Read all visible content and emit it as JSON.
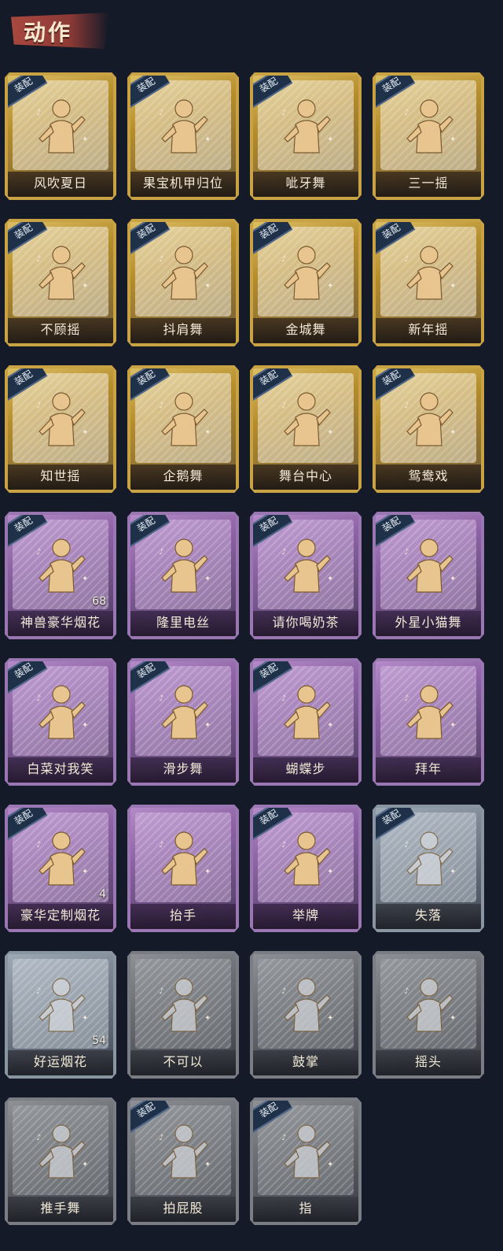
{
  "header": {
    "title": "动作"
  },
  "equip_label": "装配",
  "colors": {
    "gold": "#c9a343",
    "purple": "#9a77b2",
    "silver": "#8a95a2",
    "gray": "#7a7d84",
    "badge": "#1e3148",
    "background": "#151a28"
  },
  "cards": [
    {
      "name": "风吹夏日",
      "rarity": "gold",
      "equipped": true,
      "icon": "figure-wind-icon"
    },
    {
      "name": "果宝机甲归位",
      "rarity": "gold",
      "equipped": true,
      "icon": "figure-mecha-icon"
    },
    {
      "name": "呲牙舞",
      "rarity": "gold",
      "equipped": true,
      "icon": "figure-dance-icon"
    },
    {
      "name": "三一摇",
      "rarity": "gold",
      "equipped": true,
      "icon": "figure-shake-icon"
    },
    {
      "name": "不顾摇",
      "rarity": "gold",
      "equipped": true,
      "icon": "figure-point-icon"
    },
    {
      "name": "抖肩舞",
      "rarity": "gold",
      "equipped": true,
      "icon": "figure-shoulder-icon"
    },
    {
      "name": "金城舞",
      "rarity": "gold",
      "equipped": true,
      "icon": "figure-wave-icon"
    },
    {
      "name": "新年摇",
      "rarity": "gold",
      "equipped": true,
      "icon": "figure-newyear-icon"
    },
    {
      "name": "知世摇",
      "rarity": "gold",
      "equipped": true,
      "icon": "figure-sway-icon"
    },
    {
      "name": "企鹅舞",
      "rarity": "gold",
      "equipped": true,
      "icon": "figure-penguin-icon"
    },
    {
      "name": "舞台中心",
      "rarity": "gold",
      "equipped": true,
      "icon": "figure-stage-icon"
    },
    {
      "name": "鸳鸯戏",
      "rarity": "gold",
      "equipped": true,
      "icon": "figure-duet-icon"
    },
    {
      "name": "神兽豪华烟花",
      "rarity": "purple",
      "equipped": true,
      "icon": "fireworks-icon",
      "count": "68"
    },
    {
      "name": "隆里电丝",
      "rarity": "purple",
      "equipped": true,
      "icon": "figure-point-up-icon"
    },
    {
      "name": "请你喝奶茶",
      "rarity": "purple",
      "equipped": true,
      "icon": "figure-sign-icon"
    },
    {
      "name": "外星小猫舞",
      "rarity": "purple",
      "equipped": true,
      "icon": "figure-cat-icon"
    },
    {
      "name": "白菜对我笑",
      "rarity": "purple",
      "equipped": true,
      "icon": "figure-cross-arms-icon"
    },
    {
      "name": "滑步舞",
      "rarity": "purple",
      "equipped": true,
      "icon": "figure-slide-icon"
    },
    {
      "name": "蝴蝶步",
      "rarity": "purple",
      "equipped": true,
      "icon": "figure-butterfly-icon"
    },
    {
      "name": "拜年",
      "rarity": "purple",
      "equipped": false,
      "icon": "figure-bow-icon"
    },
    {
      "name": "豪华定制烟花",
      "rarity": "purple",
      "equipped": true,
      "icon": "fireworks-box-icon",
      "count": "4"
    },
    {
      "name": "抬手",
      "rarity": "purple",
      "equipped": false,
      "icon": "figure-raise-hand-icon"
    },
    {
      "name": "举牌",
      "rarity": "purple",
      "equipped": true,
      "icon": "figure-hold-sign-icon"
    },
    {
      "name": "失落",
      "rarity": "silver",
      "equipped": true,
      "icon": "figure-kneel-icon"
    },
    {
      "name": "好运烟花",
      "rarity": "silver",
      "equipped": false,
      "icon": "firework-tube-icon",
      "count": "54"
    },
    {
      "name": "不可以",
      "rarity": "gray",
      "equipped": false,
      "icon": "finger-wag-icon"
    },
    {
      "name": "鼓掌",
      "rarity": "gray",
      "equipped": false,
      "icon": "clap-icon"
    },
    {
      "name": "摇头",
      "rarity": "gray",
      "equipped": false,
      "icon": "figure-shake-head-icon"
    },
    {
      "name": "推手舞",
      "rarity": "gray",
      "equipped": false,
      "icon": "figure-push-icon"
    },
    {
      "name": "拍屁股",
      "rarity": "gray",
      "equipped": true,
      "icon": "figure-pat-icon"
    },
    {
      "name": "指",
      "rarity": "gray",
      "equipped": true,
      "icon": "pointing-hand-icon"
    }
  ]
}
